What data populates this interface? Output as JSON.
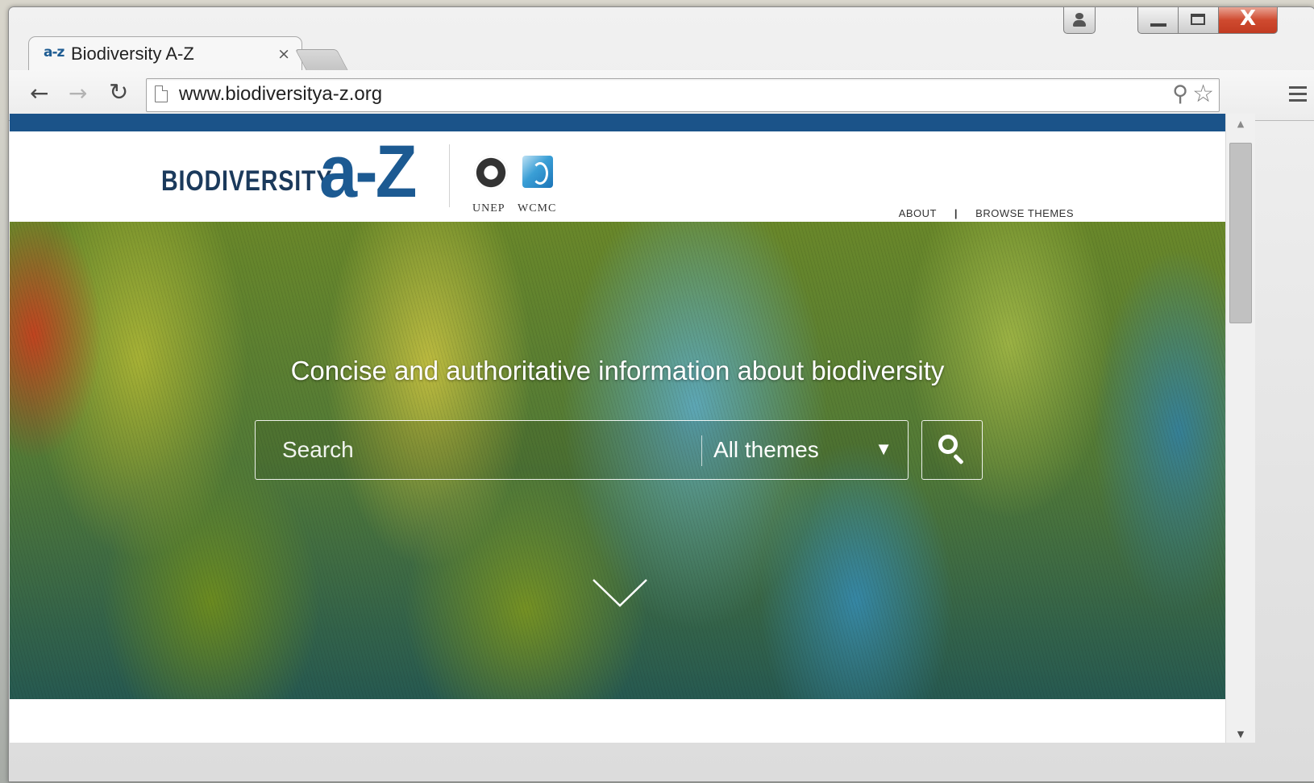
{
  "browser": {
    "tab_favicon": "a-z",
    "tab_title": "Biodiversity A-Z",
    "tab_close": "×",
    "url": "www.biodiversitya-z.org",
    "window_buttons": [
      "user-icon",
      "minimize-icon",
      "maximize-icon",
      "close-icon"
    ],
    "close_glyph": "X"
  },
  "site": {
    "logo_word": "BIODIVERSITY",
    "logo_az": "a-Z",
    "partners": [
      "UNEP",
      "WCMC"
    ],
    "nav": {
      "about": "ABOUT",
      "separator": "|",
      "browse": "BROWSE THEMES"
    },
    "accent_color": "#1b5389"
  },
  "hero": {
    "tagline": "Concise and authoritative information about biodiversity",
    "search_placeholder": "Search",
    "theme_selected": "All themes",
    "theme_arrow": "▼"
  }
}
